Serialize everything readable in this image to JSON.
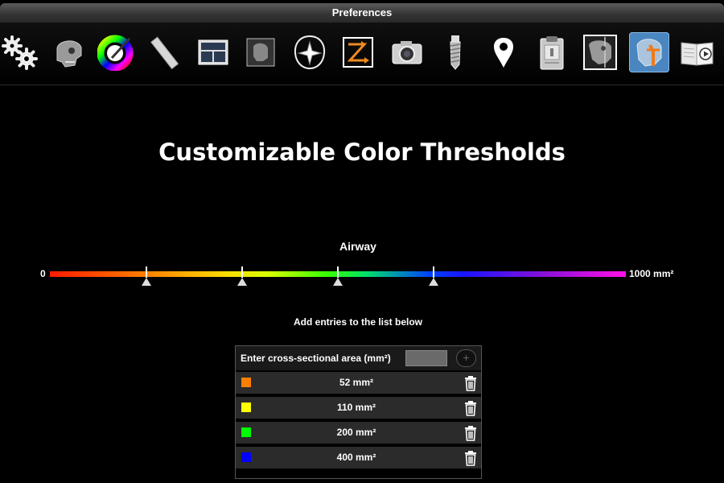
{
  "window": {
    "title": "Preferences"
  },
  "toolbar": {
    "items": [
      {
        "icon": "gears-icon"
      },
      {
        "icon": "skull-icon"
      },
      {
        "icon": "color-wheel-icon"
      },
      {
        "icon": "ruler-icon"
      },
      {
        "icon": "layout-icon"
      },
      {
        "icon": "xray-head-icon"
      },
      {
        "icon": "compass-head-icon"
      },
      {
        "icon": "zoom-arrows-icon"
      },
      {
        "icon": "camera-icon"
      },
      {
        "icon": "implant-icon"
      },
      {
        "icon": "location-pin-icon"
      },
      {
        "icon": "clipboard-icon"
      },
      {
        "icon": "ceph-xray-icon"
      },
      {
        "icon": "airway-icon",
        "selected": true
      },
      {
        "icon": "book-video-icon"
      }
    ]
  },
  "main": {
    "heading": "Customizable Color Thresholds",
    "scale": {
      "label": "Airway",
      "min_label": "0",
      "max_label": "1000 mm²",
      "min": 0,
      "max": 1000,
      "markers": [
        168,
        334,
        500,
        666
      ]
    },
    "instruction": "Add entries to the list below",
    "entry": {
      "label": "Enter cross-sectional area (mm²)",
      "value": "",
      "add_label": "+"
    },
    "thresholds": [
      {
        "value": "52 mm²",
        "color": "#ff7f00"
      },
      {
        "value": "110 mm²",
        "color": "#ffff00"
      },
      {
        "value": "200 mm²",
        "color": "#00ff00"
      },
      {
        "value": "400 mm²",
        "color": "#0000ff"
      }
    ]
  }
}
